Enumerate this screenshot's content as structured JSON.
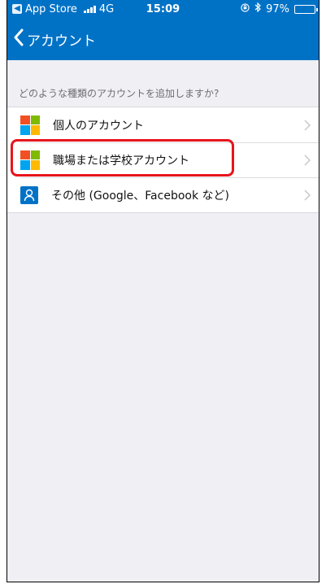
{
  "status_bar": {
    "back_app": "App Store",
    "network": "4G",
    "time": "15:09",
    "battery": "97%",
    "battery_level": 0.97
  },
  "nav": {
    "title": "アカウント"
  },
  "section": {
    "header": "どのような種類のアカウントを追加しますか?"
  },
  "accounts": [
    {
      "label": "個人のアカウント",
      "icon": "microsoft-logo-icon"
    },
    {
      "label": "職場または学校アカウント",
      "icon": "microsoft-logo-icon",
      "highlighted": true
    },
    {
      "label": "その他 (Google、Facebook など)",
      "icon": "person-icon"
    }
  ],
  "colors": {
    "brand": "#0072c6",
    "highlight": "#e8141c",
    "ms_red": "#f25022",
    "ms_green": "#7fba00",
    "ms_blue": "#00a4ef",
    "ms_yellow": "#ffb900"
  }
}
